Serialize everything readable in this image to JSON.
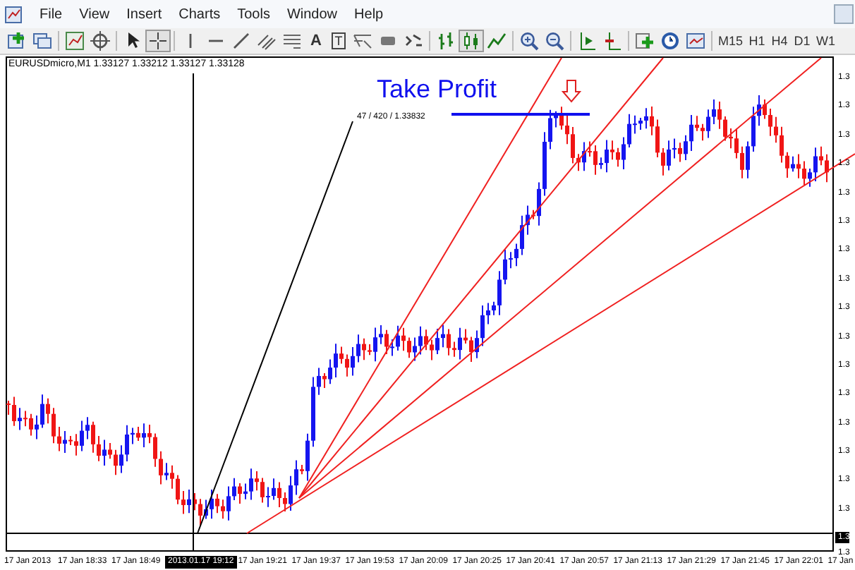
{
  "menu": {
    "items": [
      "File",
      "View",
      "Insert",
      "Charts",
      "Tools",
      "Window",
      "Help"
    ]
  },
  "toolbar": [
    {
      "kind": "newchart",
      "selected": false
    },
    {
      "kind": "profiles",
      "selected": false
    },
    {
      "kind": "separator"
    },
    {
      "kind": "marketwatch",
      "selected": false
    },
    {
      "kind": "navigator",
      "selected": false
    },
    {
      "kind": "separator"
    },
    {
      "kind": "cursor",
      "selected": false
    },
    {
      "kind": "crosshair",
      "selected": true
    },
    {
      "kind": "separator"
    },
    {
      "kind": "vline",
      "selected": false
    },
    {
      "kind": "hline",
      "selected": false
    },
    {
      "kind": "trendline",
      "selected": false
    },
    {
      "kind": "channel",
      "selected": false
    },
    {
      "kind": "fibo",
      "selected": false
    },
    {
      "kind": "glyph",
      "label": "A",
      "selected": false
    },
    {
      "kind": "boxglyph",
      "label": "T",
      "selected": false
    },
    {
      "kind": "fan",
      "selected": false
    },
    {
      "kind": "rect",
      "selected": false
    },
    {
      "kind": "arrows",
      "selected": false
    },
    {
      "kind": "separator"
    },
    {
      "kind": "bars",
      "selected": false
    },
    {
      "kind": "candles",
      "selected": true
    },
    {
      "kind": "line",
      "selected": false
    },
    {
      "kind": "separator"
    },
    {
      "kind": "zoomin",
      "selected": false
    },
    {
      "kind": "zoomout",
      "selected": false
    },
    {
      "kind": "separator"
    },
    {
      "kind": "shift",
      "selected": false
    },
    {
      "kind": "autoscroll",
      "selected": false
    },
    {
      "kind": "separator"
    },
    {
      "kind": "indicators",
      "selected": false
    },
    {
      "kind": "clock",
      "selected": false
    },
    {
      "kind": "templates",
      "selected": false
    },
    {
      "kind": "separator"
    },
    {
      "kind": "timeframe",
      "label": "M15",
      "selected": false
    },
    {
      "kind": "timeframe",
      "label": "H1",
      "selected": false
    },
    {
      "kind": "timeframe",
      "label": "H4",
      "selected": false
    },
    {
      "kind": "timeframe",
      "label": "D1",
      "selected": false
    },
    {
      "kind": "timeframe",
      "label": "W1",
      "selected": false
    }
  ],
  "chart": {
    "title": "EURUSDmicro,M1  1.33127 1.33212 1.33127 1.33128",
    "annotation": "Take Profit",
    "line_label": "47 / 420 / 1.33832",
    "price_axis": [
      {
        "kind": "tick",
        "label": "1.3"
      },
      {
        "kind": "tick",
        "label": "1.3"
      },
      {
        "kind": "tick",
        "label": "1.3"
      },
      {
        "kind": "tick",
        "label": "1.3"
      },
      {
        "kind": "tick",
        "label": "1.3"
      },
      {
        "kind": "tick",
        "label": "1.3"
      },
      {
        "kind": "tick",
        "label": "1.3"
      },
      {
        "kind": "tick",
        "label": "1.3"
      },
      {
        "kind": "tick",
        "label": "1.3"
      },
      {
        "kind": "tick",
        "label": "1.3"
      },
      {
        "kind": "tick",
        "label": "1.3"
      },
      {
        "kind": "tick",
        "label": "1.3"
      },
      {
        "kind": "tick",
        "label": "1.3"
      },
      {
        "kind": "tick",
        "label": "1.3"
      },
      {
        "kind": "tick",
        "label": "1.3"
      },
      {
        "kind": "tick",
        "label": "1.3"
      },
      {
        "kind": "cursor",
        "label": "1.3"
      },
      {
        "kind": "tick",
        "label": "1.3"
      }
    ],
    "time_axis": [
      {
        "kind": "tick",
        "label": "17 Jan 2013"
      },
      {
        "kind": "tick",
        "label": "17 Jan 18:33"
      },
      {
        "kind": "tick",
        "label": "17 Jan 18:49"
      },
      {
        "kind": "cursor",
        "label": "2013.01.17 19:12"
      },
      {
        "kind": "tick",
        "label": "17 Jan 19:21"
      },
      {
        "kind": "tick",
        "label": "17 Jan 19:37"
      },
      {
        "kind": "tick",
        "label": "17 Jan 19:53"
      },
      {
        "kind": "tick",
        "label": "17 Jan 20:09"
      },
      {
        "kind": "tick",
        "label": "17 Jan 20:25"
      },
      {
        "kind": "tick",
        "label": "17 Jan 20:41"
      },
      {
        "kind": "tick",
        "label": "17 Jan 20:57"
      },
      {
        "kind": "tick",
        "label": "17 Jan 21:13"
      },
      {
        "kind": "tick",
        "label": "17 Jan 21:29"
      },
      {
        "kind": "tick",
        "label": "17 Jan 21:45"
      },
      {
        "kind": "tick",
        "label": "17 Jan 22:01"
      },
      {
        "kind": "tick",
        "label": "17 Jan"
      }
    ]
  }
}
